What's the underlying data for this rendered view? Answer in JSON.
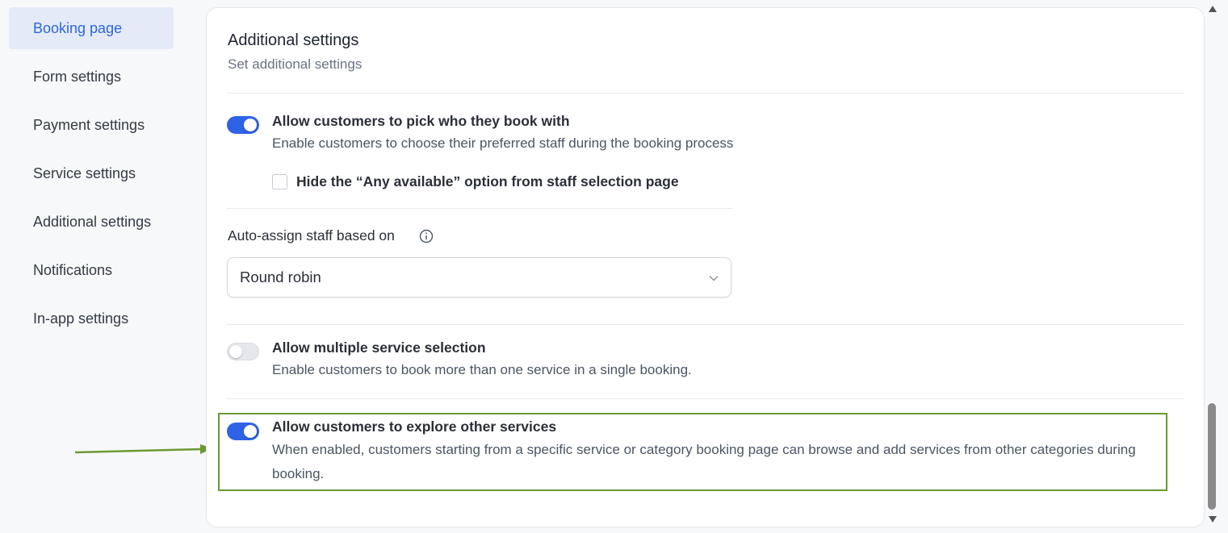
{
  "sidebar": {
    "items": [
      {
        "label": "Booking page",
        "active": true
      },
      {
        "label": "Form settings",
        "active": false
      },
      {
        "label": "Payment settings",
        "active": false
      },
      {
        "label": "Service settings",
        "active": false
      },
      {
        "label": "Additional settings",
        "active": false
      },
      {
        "label": "Notifications",
        "active": false
      },
      {
        "label": "In-app settings",
        "active": false
      }
    ]
  },
  "main": {
    "title": "Additional settings",
    "subtitle": "Set additional settings",
    "options": [
      {
        "title": "Allow customers to pick who they book with",
        "description": "Enable customers to choose their preferred staff during the booking process",
        "enabled": true
      },
      {
        "title": "Allow multiple service selection",
        "description": "Enable customers to book more than one service in a single booking.",
        "enabled": false
      },
      {
        "title": "Allow customers to explore other services",
        "description_line1": "When enabled, customers starting from a specific service or category booking page can browse and add services from other categories during",
        "description_line2": "booking.",
        "enabled": true
      }
    ],
    "hide_any_available": {
      "label": "Hide the “Any available” option from staff selection page",
      "checked": false
    },
    "auto_assign": {
      "label": "Auto-assign staff based on",
      "selected": "Round robin"
    }
  },
  "colors": {
    "accent": "#2f63e6",
    "active_nav_bg": "#e4eaf7",
    "active_nav_text": "#2f67d8",
    "annotation": "#6a9a32"
  },
  "icons": [
    "info-icon",
    "chevron-down-icon",
    "annotation-arrow-icon",
    "scroll-up-icon",
    "scroll-down-icon"
  ]
}
